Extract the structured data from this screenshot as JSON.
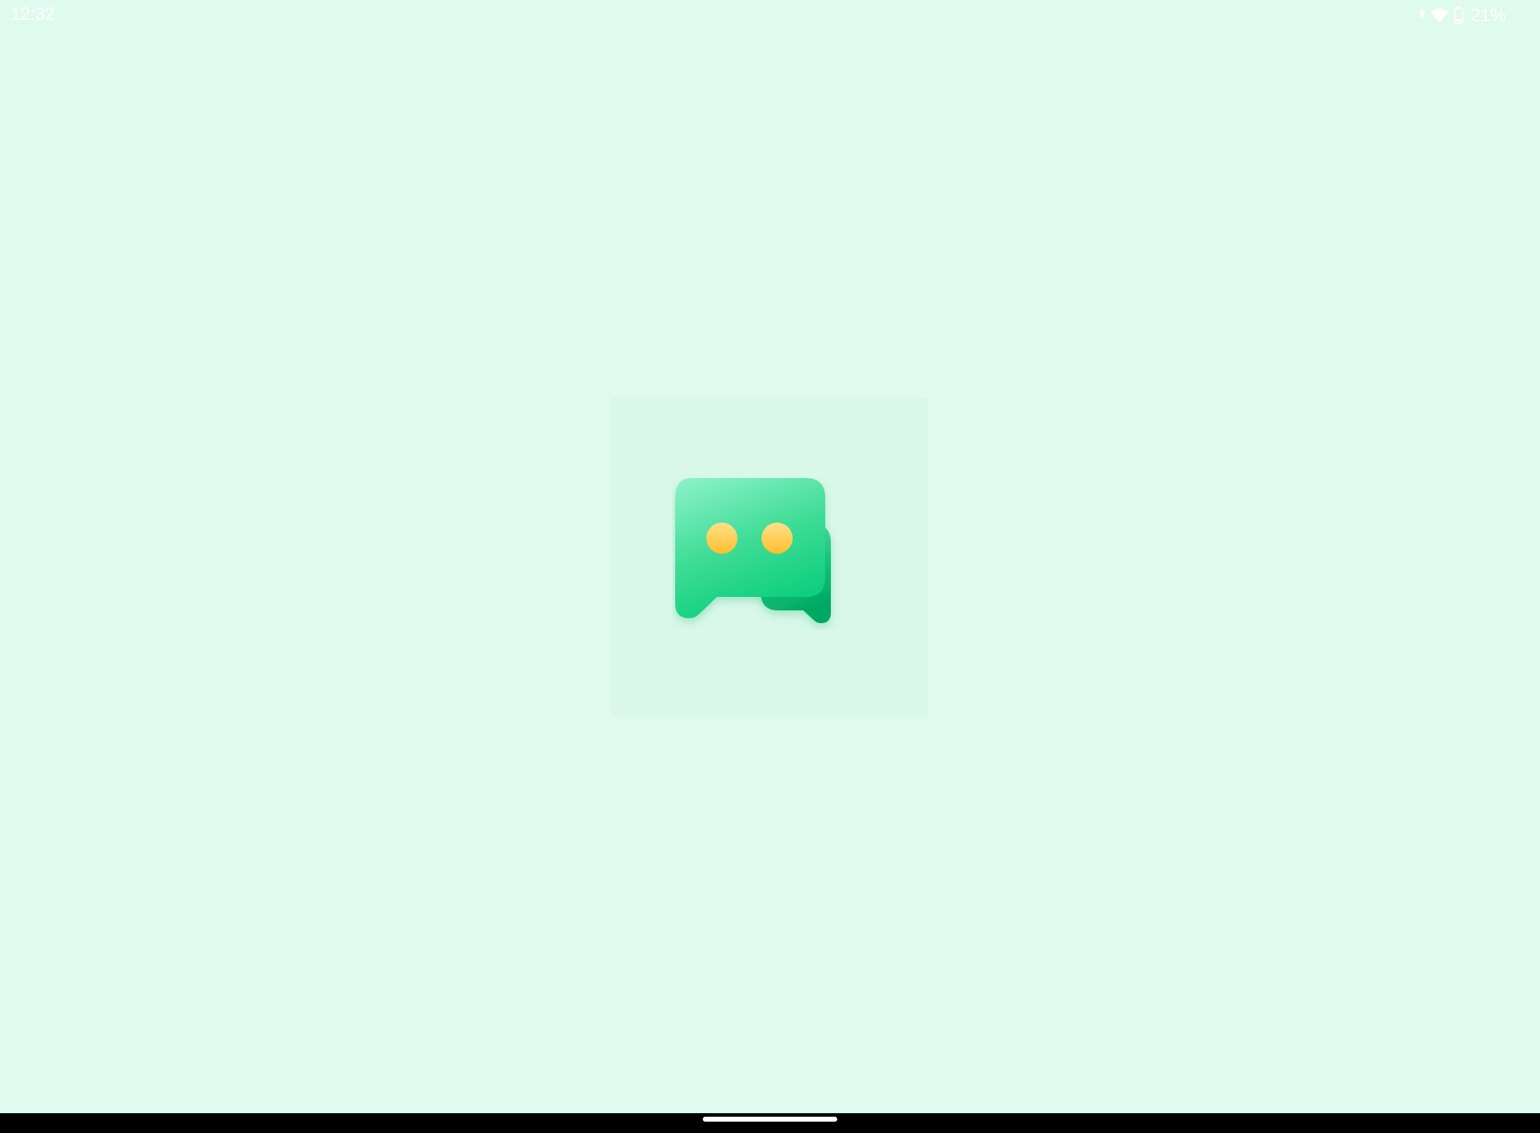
{
  "status_bar": {
    "time": "12:32",
    "battery_percent": "21%",
    "icons": [
      "bluetooth-icon",
      "wifi-icon",
      "battery-icon"
    ]
  },
  "splash": {
    "logo_icon": "chat-bubbles-icon"
  },
  "colors": {
    "background": "#dffaee",
    "bubble_green": "#10cf7f",
    "bubble_light": "#8ff3c9",
    "dot_yellow": "#ffc93d"
  }
}
